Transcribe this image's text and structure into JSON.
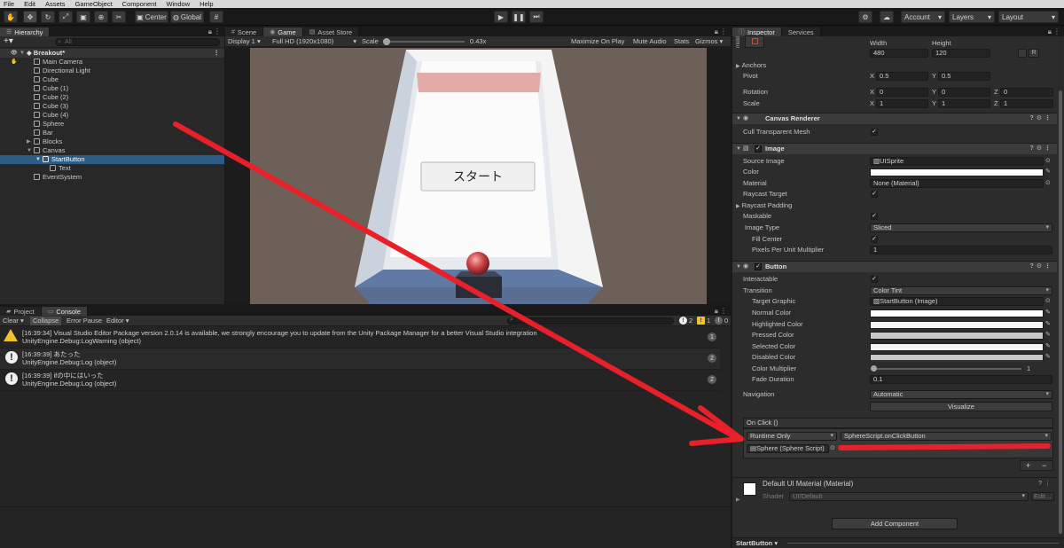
{
  "menubar": [
    "File",
    "Edit",
    "Assets",
    "GameObject",
    "Component",
    "Window",
    "Help"
  ],
  "toolbar": {
    "pivot_center": "Center",
    "space_global": "Global",
    "account": "Account",
    "layers": "Layers",
    "layout": "Layout"
  },
  "hierarchy": {
    "tab": "Hierarchy",
    "search_placeholder": "All",
    "scene": "Breakout*",
    "items": [
      "Main Camera",
      "Directional Light",
      "Cube",
      "Cube (1)",
      "Cube (2)",
      "Cube (3)",
      "Cube (4)",
      "Sphere",
      "Bar",
      "Blocks",
      "Canvas",
      "StartButton",
      "Text",
      "EventSystem"
    ]
  },
  "game": {
    "tabs": [
      "Scene",
      "Game",
      "Asset Store"
    ],
    "display": "Display 1",
    "resolution": "Full HD (1920x1080)",
    "scale_label": "Scale",
    "scale_value": "0.43x",
    "scale_fraction": 0.43,
    "maximize": "Maximize On Play",
    "mute": "Mute Audio",
    "stats": "Stats",
    "gizmos": "Gizmos",
    "start_button_text": "スタート"
  },
  "console": {
    "tabs": [
      "Project",
      "Console"
    ],
    "clear": "Clear",
    "collapse": "Collapse",
    "error_pause": "Error Pause",
    "editor": "Editor",
    "counts": {
      "info": "2",
      "warn": "1",
      "error": "0"
    },
    "logs": [
      {
        "type": "warning",
        "line1": "[16:39:34] Visual Studio Editor Package version 2.0.14 is available, we strongly encourage you to update from the Unity Package Manager for a better Visual Studio integration",
        "line2": "UnityEngine.Debug:LogWarning (object)",
        "count": "1"
      },
      {
        "type": "info",
        "line1": "[16:39:39] あたった",
        "line2": "UnityEngine.Debug:Log (object)",
        "count": "2"
      },
      {
        "type": "info",
        "line1": "[16:39:39] ifの中にはいった",
        "line2": "UnityEngine.Debug:Log (object)",
        "count": "2"
      }
    ]
  },
  "inspector": {
    "tabs": [
      "Inspector",
      "Services"
    ],
    "anchor_label": "midd",
    "width_label": "Width",
    "height_label": "Height",
    "width": "480",
    "height": "120",
    "r_label": "R",
    "anchors": "Anchors",
    "pivot": "Pivot",
    "pivot_x": "0.5",
    "pivot_y": "0.5",
    "rotation": "Rotation",
    "rot_x": "0",
    "rot_y": "0",
    "rot_z": "0",
    "scale": "Scale",
    "scale_x": "1",
    "scale_y": "1",
    "scale_z": "1",
    "axis_x": "X",
    "axis_y": "Y",
    "axis_z": "Z",
    "canvas_renderer": "Canvas Renderer",
    "cull_transparent": "Cull Transparent Mesh",
    "image": "Image",
    "source_image": "Source Image",
    "source_image_value": "UISprite",
    "color": "Color",
    "material": "Material",
    "material_value": "None (Material)",
    "raycast_target": "Raycast Target",
    "raycast_padding": "Raycast Padding",
    "maskable": "Maskable",
    "image_type": "Image Type",
    "image_type_value": "Sliced",
    "fill_center": "Fill Center",
    "ppu_multiplier": "Pixels Per Unit Multiplier",
    "ppu_value": "1",
    "button": "Button",
    "interactable": "Interactable",
    "transition": "Transition",
    "transition_value": "Color Tint",
    "target_graphic": "Target Graphic",
    "target_graphic_value": "StartButton (Image)",
    "normal_color": "Normal Color",
    "highlighted_color": "Highlighted Color",
    "pressed_color": "Pressed Color",
    "selected_color": "Selected Color",
    "disabled_color": "Disabled Color",
    "color_multiplier": "Color Multiplier",
    "color_multiplier_value": "1",
    "fade_duration": "Fade Duration",
    "fade_duration_value": "0.1",
    "navigation": "Navigation",
    "navigation_value": "Automatic",
    "visualize": "Visualize",
    "on_click": "On Click ()",
    "runtime_only": "Runtime Only",
    "function": "SphereScript.onClickButton",
    "target_object": "Sphere (Sphere Script)",
    "plus": "+",
    "minus": "−",
    "default_material": "Default UI Material (Material)",
    "shader_label": "Shader",
    "shader_value": "UI/Default",
    "edit": "Edit...",
    "add_component": "Add Component",
    "footer": "StartButton"
  },
  "colors": {
    "selection": "#2c5d87",
    "annotation_red": "#e8202a",
    "warning_yellow": "#f2c12e"
  }
}
